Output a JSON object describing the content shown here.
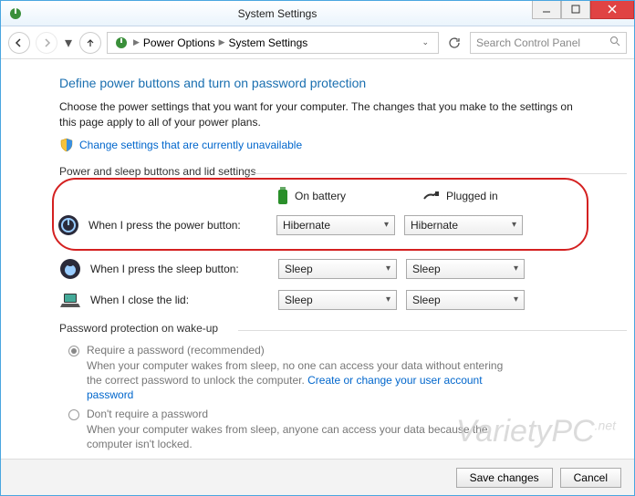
{
  "window": {
    "title": "System Settings"
  },
  "toolbar": {
    "breadcrumb": [
      "Power Options",
      "System Settings"
    ],
    "search_placeholder": "Search Control Panel"
  },
  "page": {
    "heading": "Define power buttons and turn on password protection",
    "description": "Choose the power settings that you want for your computer. The changes that you make to the settings on this page apply to all of your power plans.",
    "admin_link": "Change settings that are currently unavailable"
  },
  "group1": {
    "legend": "Power and sleep buttons and lid settings",
    "col_battery": "On battery",
    "col_plugged": "Plugged in",
    "rows": [
      {
        "label": "When I press the power button:",
        "battery": "Hibernate",
        "plugged": "Hibernate"
      },
      {
        "label": "When I press the sleep button:",
        "battery": "Sleep",
        "plugged": "Sleep"
      },
      {
        "label": "When I close the lid:",
        "battery": "Sleep",
        "plugged": "Sleep"
      }
    ]
  },
  "group2": {
    "legend": "Password protection on wake-up",
    "opt1_title": "Require a password (recommended)",
    "opt1_desc_a": "When your computer wakes from sleep, no one can access your data without entering the correct password to unlock the computer. ",
    "opt1_link": "Create or change your user account password",
    "opt2_title": "Don't require a password",
    "opt2_desc": "When your computer wakes from sleep, anyone can access your data because the computer isn't locked."
  },
  "footer": {
    "save": "Save changes",
    "cancel": "Cancel"
  },
  "watermark": "VarietyPC"
}
